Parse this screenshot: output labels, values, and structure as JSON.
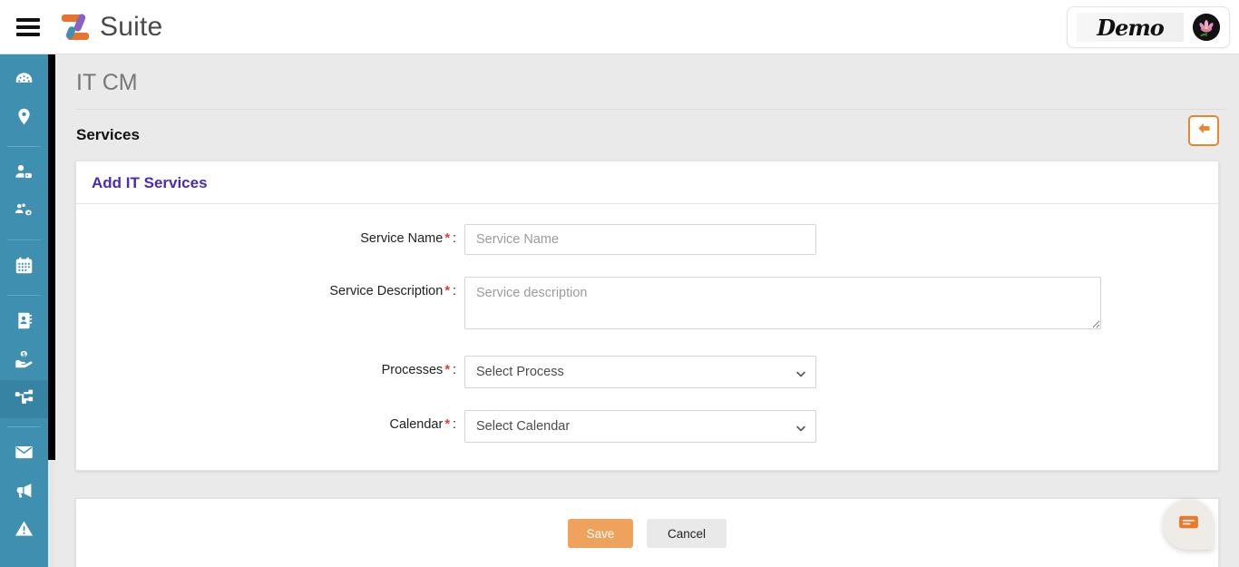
{
  "topbar": {
    "menu_icon": "hamburger-icon",
    "brand_name": "Suite",
    "logo_icon": "z-logo-icon",
    "demo_label": "Demo",
    "avatar_icon": "flower-avatar-icon"
  },
  "sidebar": {
    "items": [
      {
        "icon": "dashboard-gauge-icon",
        "active": false
      },
      {
        "icon": "location-pin-icon",
        "active": false
      },
      {
        "icon": "user-tag-icon",
        "active": false
      },
      {
        "icon": "users-gear-icon",
        "active": false
      },
      {
        "icon": "calendar-icon",
        "active": false
      },
      {
        "icon": "address-book-icon",
        "active": false
      },
      {
        "icon": "hand-holding-dollar-icon",
        "active": false
      },
      {
        "icon": "sitemap-icon",
        "active": true
      },
      {
        "icon": "envelope-icon",
        "active": false
      },
      {
        "icon": "megaphone-icon",
        "active": false
      },
      {
        "icon": "warning-triangle-icon",
        "active": false
      }
    ]
  },
  "page": {
    "title": "IT CM",
    "breadcrumb": "Services",
    "back_button_icon": "arrow-left-icon"
  },
  "form_card": {
    "heading": "Add IT Services",
    "fields": [
      {
        "label": "Service Name",
        "required_marker": "*",
        "colon": ":",
        "type": "text",
        "value": "",
        "placeholder": "Service Name"
      },
      {
        "label": "Service Description",
        "required_marker": "*",
        "colon": ":",
        "type": "textarea",
        "value": "",
        "placeholder": "Service description"
      },
      {
        "label": "Processes",
        "required_marker": "*",
        "colon": ":",
        "type": "select",
        "value": "Select Process",
        "options": [
          "Select Process"
        ]
      },
      {
        "label": "Calendar",
        "required_marker": "*",
        "colon": ":",
        "type": "select",
        "value": "Select Calendar",
        "options": [
          "Select Calendar"
        ]
      }
    ]
  },
  "actions": {
    "save_label": "Save",
    "cancel_label": "Cancel"
  },
  "chat": {
    "icon": "chat-message-icon"
  },
  "colors": {
    "sidebar": "#3f8fb0",
    "sidebar_active": "#3683a3",
    "accent_orange": "#e8862c",
    "save_orange": "#efa25c",
    "heading_purple": "#4b2ab5",
    "required_red": "#e03b3b",
    "page_bg": "#eaeaea"
  }
}
